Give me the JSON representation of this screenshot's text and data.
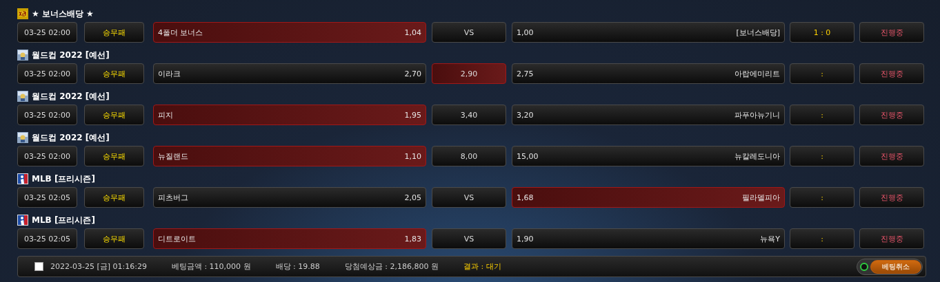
{
  "games": [
    {
      "league": {
        "name": "★ 보너스배당 ★",
        "kind": "bonus"
      },
      "time": "03-25 02:00",
      "bet_type": "승무패",
      "home": {
        "name": "4폴더 보너스",
        "odds": "1,04",
        "selected": true
      },
      "draw": {
        "text": "VS",
        "selected": false
      },
      "away": {
        "odds": "1,00",
        "name": "[보너스배당]",
        "selected": false
      },
      "score": "1 : 0",
      "status": "진행중"
    },
    {
      "league": {
        "name": "월드컵 2022 [예선]",
        "kind": "worldcup"
      },
      "time": "03-25 02:00",
      "bet_type": "승무패",
      "home": {
        "name": "이라크",
        "odds": "2,70",
        "selected": false
      },
      "draw": {
        "text": "2,90",
        "selected": true
      },
      "away": {
        "odds": "2,75",
        "name": "아랍에미리트",
        "selected": false
      },
      "score": ":",
      "status": "진행중"
    },
    {
      "league": {
        "name": "월드컵 2022 [예선]",
        "kind": "worldcup"
      },
      "time": "03-25 02:00",
      "bet_type": "승무패",
      "home": {
        "name": "피지",
        "odds": "1,95",
        "selected": true
      },
      "draw": {
        "text": "3,40",
        "selected": false
      },
      "away": {
        "odds": "3,20",
        "name": "파푸아뉴기니",
        "selected": false
      },
      "score": ":",
      "status": "진행중"
    },
    {
      "league": {
        "name": "월드컵 2022 [예선]",
        "kind": "worldcup"
      },
      "time": "03-25 02:00",
      "bet_type": "승무패",
      "home": {
        "name": "뉴질랜드",
        "odds": "1,10",
        "selected": true
      },
      "draw": {
        "text": "8,00",
        "selected": false
      },
      "away": {
        "odds": "15,00",
        "name": "뉴칼레도니아",
        "selected": false
      },
      "score": ":",
      "status": "진행중"
    },
    {
      "league": {
        "name": "MLB [프리시즌]",
        "kind": "mlb"
      },
      "time": "03-25 02:05",
      "bet_type": "승무패",
      "home": {
        "name": "피츠버그",
        "odds": "2,05",
        "selected": false
      },
      "draw": {
        "text": "VS",
        "selected": false
      },
      "away": {
        "odds": "1,68",
        "name": "필라델피아",
        "selected": true
      },
      "score": ":",
      "status": "진행중"
    },
    {
      "league": {
        "name": "MLB [프리시즌]",
        "kind": "mlb"
      },
      "time": "03-25 02:05",
      "bet_type": "승무패",
      "home": {
        "name": "디트로이트",
        "odds": "1,83",
        "selected": true
      },
      "draw": {
        "text": "VS",
        "selected": false
      },
      "away": {
        "odds": "1,90",
        "name": "뉴욕Y",
        "selected": false
      },
      "score": ":",
      "status": "진행중"
    }
  ],
  "summary": {
    "checked": false,
    "datetime": "2022-03-25 [금] 01:16:29",
    "bet_amount": "베팅금액 : 110,000 원",
    "odds": "배당 : 19.88",
    "expected": "당첨예상금 : 2,186,800 원",
    "result": "결과 : 대기",
    "cancel_button": "베팅취소"
  }
}
